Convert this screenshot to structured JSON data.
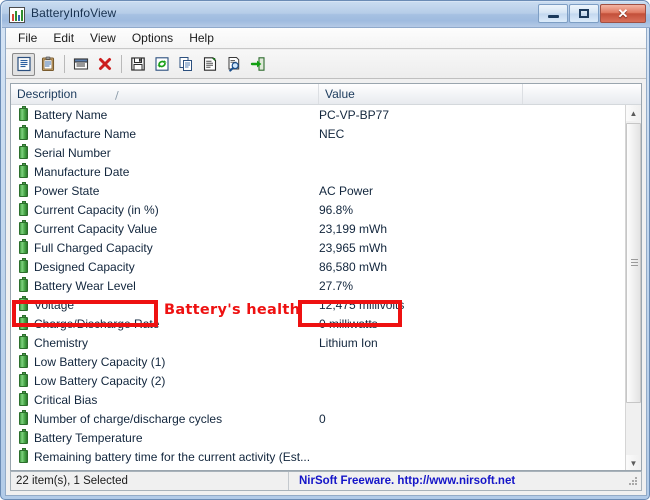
{
  "window": {
    "title": "BatteryInfoView",
    "icon": "battery-bars-icon",
    "controls": {
      "minimize": "minimize-button",
      "maximize": "maximize-button",
      "close": "close-button",
      "close_glyph": "✕"
    }
  },
  "menu": {
    "items": [
      {
        "label": "File"
      },
      {
        "label": "Edit"
      },
      {
        "label": "View"
      },
      {
        "label": "Options"
      },
      {
        "label": "Help"
      }
    ]
  },
  "toolbar": {
    "buttons": [
      {
        "name": "properties-view-icon",
        "pressed": true
      },
      {
        "name": "clipboard-icon",
        "pressed": false
      },
      {
        "name": "separator"
      },
      {
        "name": "window-report-icon",
        "pressed": false
      },
      {
        "name": "delete-red-x-icon",
        "pressed": false
      },
      {
        "name": "separator"
      },
      {
        "name": "save-floppy-icon",
        "pressed": false
      },
      {
        "name": "refresh-icon",
        "pressed": false
      },
      {
        "name": "copy-icon",
        "pressed": false
      },
      {
        "name": "properties-page-icon",
        "pressed": false
      },
      {
        "name": "find-icon",
        "pressed": false
      },
      {
        "name": "exit-icon",
        "pressed": false
      }
    ]
  },
  "listview": {
    "columns": [
      {
        "label": "Description",
        "sort_indicator": "/"
      },
      {
        "label": "Value"
      },
      {
        "label": ""
      }
    ],
    "rows": [
      {
        "description": "Battery Name",
        "value": "PC-VP-BP77"
      },
      {
        "description": "Manufacture Name",
        "value": "NEC"
      },
      {
        "description": "Serial Number",
        "value": ""
      },
      {
        "description": "Manufacture Date",
        "value": ""
      },
      {
        "description": "Power State",
        "value": "AC Power"
      },
      {
        "description": "Current Capacity (in %)",
        "value": "96.8%"
      },
      {
        "description": "Current Capacity Value",
        "value": "23,199 mWh"
      },
      {
        "description": "Full Charged Capacity",
        "value": "23,965 mWh"
      },
      {
        "description": "Designed Capacity",
        "value": "86,580 mWh"
      },
      {
        "description": "Battery Wear Level",
        "value": "27.7%"
      },
      {
        "description": "Voltage",
        "value": "12,475 millivolts"
      },
      {
        "description": "Charge/Discharge Rate",
        "value": "0 milliwatts"
      },
      {
        "description": "Chemistry",
        "value": "Lithium Ion"
      },
      {
        "description": "Low Battery Capacity (1)",
        "value": ""
      },
      {
        "description": "Low Battery Capacity (2)",
        "value": ""
      },
      {
        "description": "Critical Bias",
        "value": ""
      },
      {
        "description": "Number of charge/discharge cycles",
        "value": "0"
      },
      {
        "description": "Battery Temperature",
        "value": ""
      },
      {
        "description": "Remaining battery time for the current activity (Est...",
        "value": ""
      }
    ]
  },
  "scrollbar": {
    "up_glyph": "▲",
    "down_glyph": "▼"
  },
  "statusbar": {
    "left": "22 item(s), 1 Selected",
    "right": "NirSoft Freeware.  http://www.nirsoft.net",
    "link_color": "#1414c8"
  },
  "annotations": {
    "text": "Battery's health",
    "color": "#ee1111",
    "boxes": [
      {
        "name": "wear-level-label-highlight"
      },
      {
        "name": "wear-level-value-highlight"
      }
    ]
  }
}
